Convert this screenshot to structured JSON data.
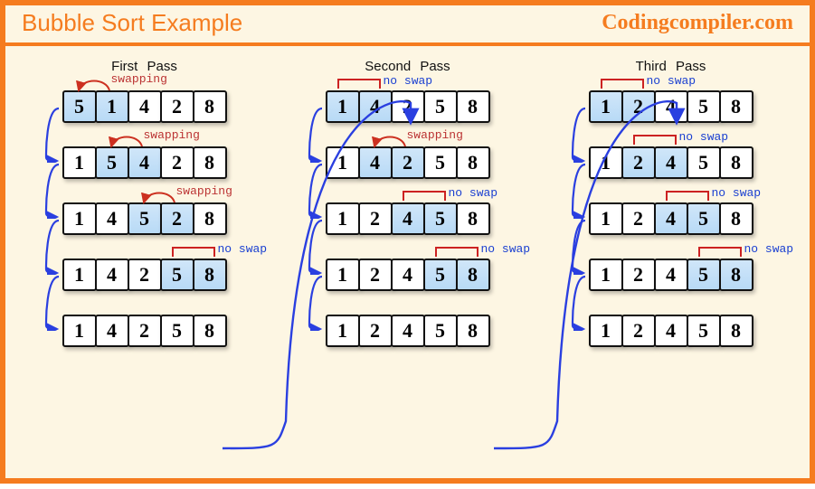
{
  "header": {
    "title": "Bubble Sort Example",
    "site": "Codingcompiler.com"
  },
  "labels": {
    "swapping": "swapping",
    "noswap": "no swap"
  },
  "passes": [
    {
      "title": "First  Pass",
      "steps": [
        {
          "values": [
            5,
            1,
            4,
            2,
            8
          ],
          "highlight": [
            0,
            1
          ],
          "label": "swapping",
          "labelKind": "swap",
          "labelAt": 0
        },
        {
          "values": [
            1,
            5,
            4,
            2,
            8
          ],
          "highlight": [
            1,
            2
          ],
          "label": "swapping",
          "labelKind": "swap",
          "labelAt": 1
        },
        {
          "values": [
            1,
            4,
            5,
            2,
            8
          ],
          "highlight": [
            2,
            3
          ],
          "label": "swapping",
          "labelKind": "swap",
          "labelAt": 2
        },
        {
          "values": [
            1,
            4,
            2,
            5,
            8
          ],
          "highlight": [
            3,
            4
          ],
          "label": "no swap",
          "labelKind": "noswap",
          "labelAt": 3
        },
        {
          "values": [
            1,
            4,
            2,
            5,
            8
          ],
          "highlight": [],
          "label": null
        }
      ]
    },
    {
      "title": "Second  Pass",
      "steps": [
        {
          "values": [
            1,
            4,
            2,
            5,
            8
          ],
          "highlight": [
            0,
            1
          ],
          "label": "no swap",
          "labelKind": "noswap",
          "labelAt": 0
        },
        {
          "values": [
            1,
            4,
            2,
            5,
            8
          ],
          "highlight": [
            1,
            2
          ],
          "label": "swapping",
          "labelKind": "swap",
          "labelAt": 1
        },
        {
          "values": [
            1,
            2,
            4,
            5,
            8
          ],
          "highlight": [
            2,
            3
          ],
          "label": "no swap",
          "labelKind": "noswap",
          "labelAt": 2
        },
        {
          "values": [
            1,
            2,
            4,
            5,
            8
          ],
          "highlight": [
            3,
            4
          ],
          "label": "no swap",
          "labelKind": "noswap",
          "labelAt": 3
        },
        {
          "values": [
            1,
            2,
            4,
            5,
            8
          ],
          "highlight": [],
          "label": null
        }
      ]
    },
    {
      "title": "Third  Pass",
      "steps": [
        {
          "values": [
            1,
            2,
            4,
            5,
            8
          ],
          "highlight": [
            0,
            1
          ],
          "label": "no swap",
          "labelKind": "noswap",
          "labelAt": 0
        },
        {
          "values": [
            1,
            2,
            4,
            5,
            8
          ],
          "highlight": [
            1,
            2
          ],
          "label": "no swap",
          "labelKind": "noswap",
          "labelAt": 1
        },
        {
          "values": [
            1,
            2,
            4,
            5,
            8
          ],
          "highlight": [
            2,
            3
          ],
          "label": "no swap",
          "labelKind": "noswap",
          "labelAt": 2
        },
        {
          "values": [
            1,
            2,
            4,
            5,
            8
          ],
          "highlight": [
            3,
            4
          ],
          "label": "no swap",
          "labelKind": "noswap",
          "labelAt": 3
        },
        {
          "values": [
            1,
            2,
            4,
            5,
            8
          ],
          "highlight": [],
          "label": null
        }
      ]
    }
  ]
}
